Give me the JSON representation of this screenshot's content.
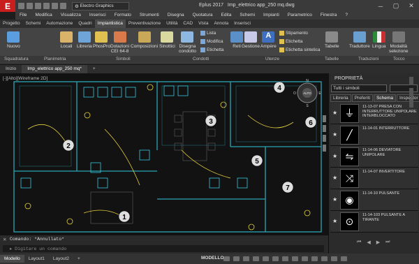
{
  "app": {
    "title": "Eplus 2017",
    "file": "Imp_elettrico app_250 mq.dwg",
    "logo": "E",
    "workspace": "Electro Graphics"
  },
  "menu": [
    "File",
    "Modifica",
    "Visualizza",
    "Inserisci",
    "Formato",
    "Strumenti",
    "Disegna",
    "Quotatura",
    "Edita",
    "Schemi",
    "Impianti",
    "Parametrico",
    "Finestra",
    "?"
  ],
  "ribbon_tabs": [
    {
      "label": "Progetto",
      "active": false
    },
    {
      "label": "Schemi",
      "active": false
    },
    {
      "label": "Automazione",
      "active": false
    },
    {
      "label": "Quadri",
      "active": false
    },
    {
      "label": "Impiantistica",
      "active": true
    },
    {
      "label": "Preventivazione",
      "active": false
    },
    {
      "label": "Utilità",
      "active": false
    },
    {
      "label": "CAD",
      "active": false
    },
    {
      "label": "Vista",
      "active": false
    },
    {
      "label": "Annota",
      "active": false
    },
    {
      "label": "Inserisci",
      "active": false
    }
  ],
  "ribbon": {
    "nuovo": "Nuovo",
    "locali": "Locali",
    "libreria": "Libreria",
    "phospro": "PhosPro",
    "dotazioni": "Dotazioni\nCEI 64-8",
    "composizioni": "Composizioni",
    "sinottici": "Sinottici",
    "disegna_condotto": "Disegna\ncondotto",
    "lista": "Lista",
    "modifica": "Modifica",
    "etichetta": "Etichetta",
    "reti": "Reti",
    "gestione": "Gestione",
    "ampere": "Ampère",
    "stipamento": "Stipamento",
    "etichetta2": "Etichetta",
    "etichetta_sintetica": "Etichetta sintetica",
    "tabelle": "Tabelle",
    "traduttore": "Traduttore",
    "lingua": "Lingua",
    "modalita": "Modalità\nselezione"
  },
  "panels": [
    "Squadratura",
    "Planimetria",
    "Simboli",
    "Condotti",
    "Utenze",
    "Tabelle",
    "Traduzioni",
    "Tocco"
  ],
  "doc_tabs": [
    {
      "label": "Inizio",
      "active": false
    },
    {
      "label": "Imp_elettrico app_250 mq*",
      "active": true
    }
  ],
  "viewport_label": "[-][Alto][Wireframe 2D]",
  "compass": {
    "n": "N",
    "s": "S",
    "e": "E",
    "w": "O",
    "center": "ALTO"
  },
  "room_numbers": [
    "1",
    "2",
    "3",
    "4",
    "5",
    "6",
    "7"
  ],
  "command": {
    "history": "Comando: *Annullato*",
    "placeholder": "Digitare un comando"
  },
  "layout_tabs": [
    {
      "label": "Modello",
      "active": true
    },
    {
      "label": "Layout1",
      "active": false
    },
    {
      "label": "Layout2",
      "active": false
    }
  ],
  "status_mode": "MODELLO",
  "properties": {
    "title": "PROPRIETÀ",
    "filter": "Tutti i simboli",
    "tabs": [
      {
        "label": "Libreria",
        "active": false
      },
      {
        "label": "Preferiti",
        "active": false
      },
      {
        "label": "Schema",
        "active": true
      },
      {
        "label": "Inspector",
        "active": false
      }
    ],
    "items": [
      {
        "label": "11-13-07 PRESA CON INTERRUTTORE UNIPOLARE INTERBLOCCATO"
      },
      {
        "label": "11-14-01 INTERRUTTORE"
      },
      {
        "label": "11-14-06 DEVIATORE UNIPOLARE"
      },
      {
        "label": "11-14-07 INVERTITORE"
      },
      {
        "label": "11-14-10 PULSANTE"
      },
      {
        "label": "11-14-103 PULSANTE A TIRANTE"
      }
    ]
  },
  "colors": {
    "accent": "#c81e1e",
    "cyan": "#39c9e0",
    "yellow": "#e8d23a",
    "wall": "#2aa6b5"
  }
}
